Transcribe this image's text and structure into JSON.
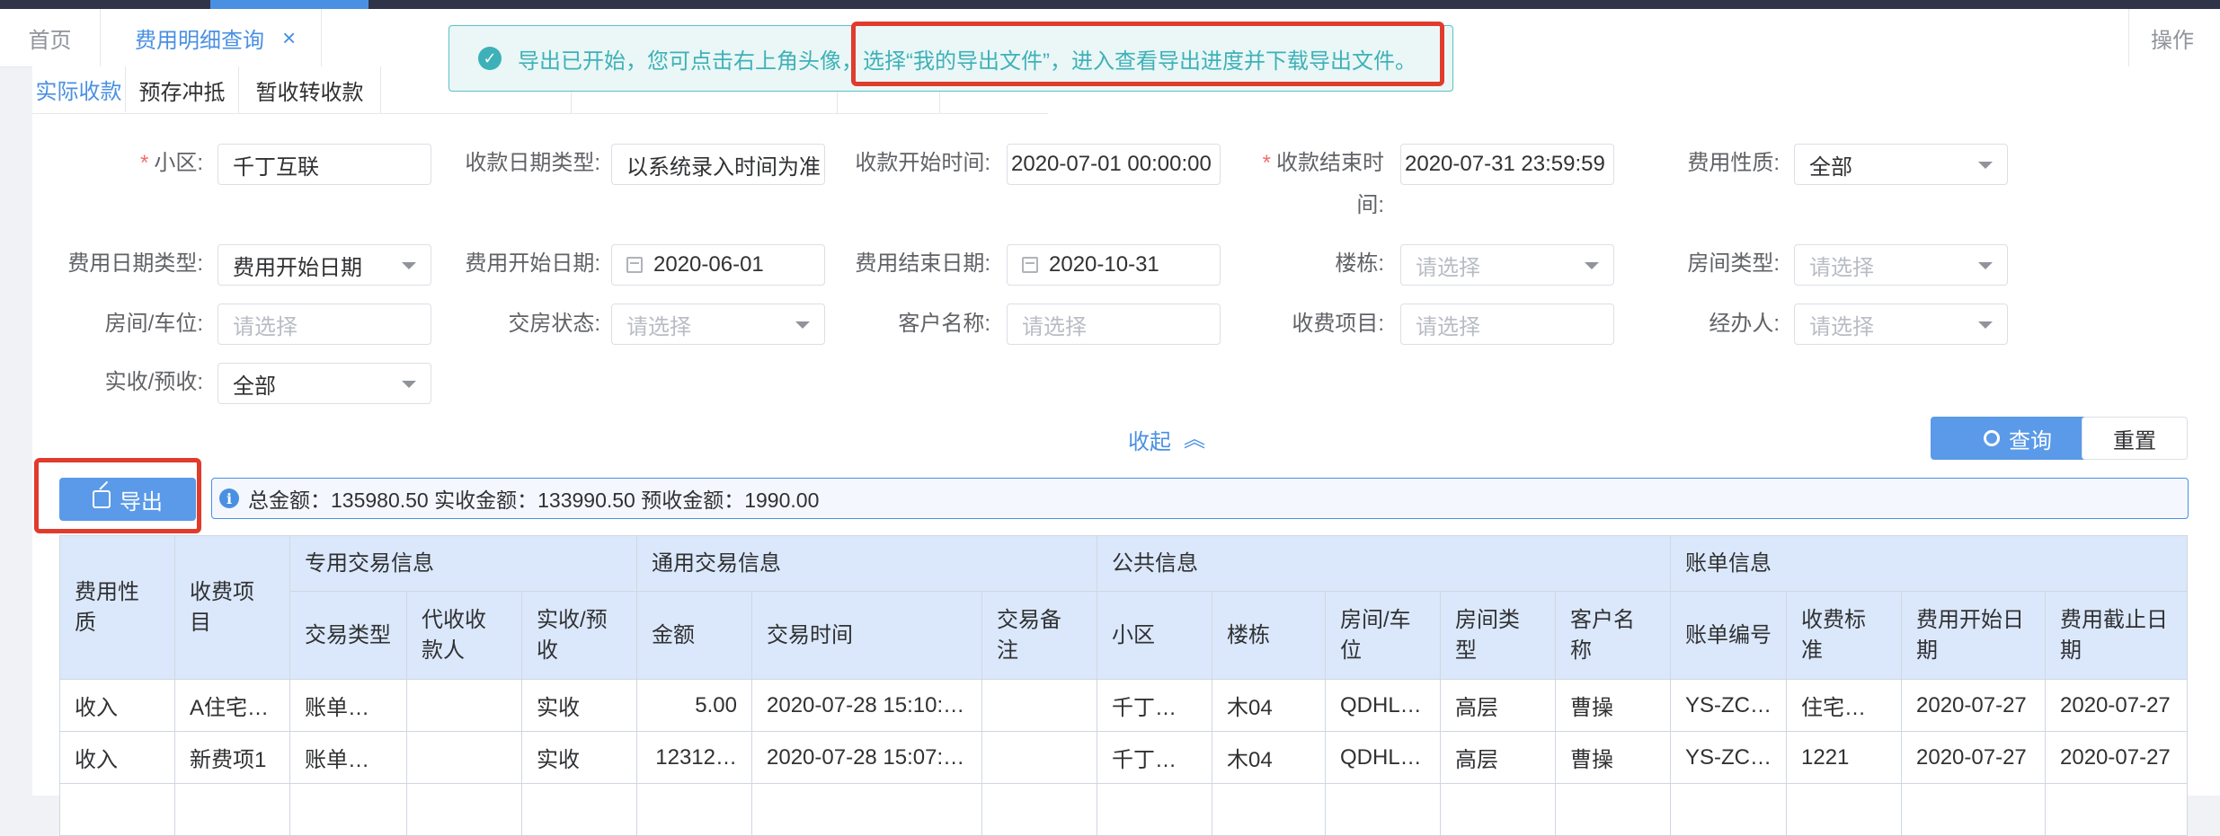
{
  "tabs": {
    "home": "首页",
    "current": "费用明细查询",
    "close": "×",
    "ops": "操作"
  },
  "subtabs": [
    "实际收款",
    "预存冲抵",
    "暂收转收款",
    "",
    "",
    ""
  ],
  "form": {
    "row1": [
      {
        "label": "小区:",
        "required": true,
        "value": "千丁互联",
        "type": "text"
      },
      {
        "label": "收款日期类型:",
        "required": false,
        "value": "以系统录入时间为准",
        "type": "text"
      },
      {
        "label": "收款开始时间:",
        "required": false,
        "value": "2020-07-01 00:00:00",
        "type": "text"
      },
      {
        "label": "收款结束时间:",
        "required": true,
        "value": "2020-07-31 23:59:59",
        "type": "text"
      },
      {
        "label": "费用性质:",
        "required": false,
        "value": "全部",
        "type": "select"
      }
    ],
    "row1_label4_part1": "收款结束时",
    "row1_label4_part2": "间:",
    "row2": [
      {
        "label": "费用日期类型:",
        "value": "费用开始日期",
        "type": "select"
      },
      {
        "label": "费用开始日期:",
        "value": "2020-06-01",
        "type": "date"
      },
      {
        "label": "费用结束日期:",
        "value": "2020-10-31",
        "type": "date"
      },
      {
        "label": "楼栋:",
        "value": "请选择",
        "type": "select-ph"
      },
      {
        "label": "房间类型:",
        "value": "请选择",
        "type": "select-ph"
      }
    ],
    "row3": [
      {
        "label": "房间/车位:",
        "value": "请选择",
        "type": "text-ph"
      },
      {
        "label": "交房状态:",
        "value": "请选择",
        "type": "select-ph"
      },
      {
        "label": "客户名称:",
        "value": "请选择",
        "type": "text-ph"
      },
      {
        "label": "收费项目:",
        "value": "请选择",
        "type": "text-ph"
      },
      {
        "label": "经办人:",
        "value": "请选择",
        "type": "select-ph"
      }
    ],
    "row4": [
      {
        "label": "实收/预收:",
        "value": "全部",
        "type": "select"
      }
    ]
  },
  "actions": {
    "collapse": "收起",
    "query": "查询",
    "reset": "重置",
    "export": "导出"
  },
  "summary": "总金额：135980.50 实收金额：133990.50 预收金额：1990.00",
  "toast": {
    "text": "导出已开始，您可点击右上角头像，选择“我的导出文件”，进入查看导出进度并下载导出文件。"
  },
  "table": {
    "groups": [
      "专用交易信息",
      "通用交易信息",
      "公共信息",
      "账单信息"
    ],
    "lead_headers": [
      "费用性质",
      "收费项目"
    ],
    "sub_headers": [
      "交易类型",
      "代收收款人",
      "实收/预收",
      "金额",
      "交易时间",
      "交易备注",
      "小区",
      "楼栋",
      "房间/车位",
      "房间类型",
      "客户名称",
      "账单编号",
      "收费标准",
      "费用开始日期",
      "费用截止日期"
    ],
    "rows": [
      [
        "收入",
        "A住宅…",
        "账单…",
        "",
        "实收",
        "5.00",
        "2020-07-28 15:10:…",
        "",
        "千丁…",
        "木04",
        "QDHL…",
        "高层",
        "曹操",
        "YS-ZC…",
        "住宅…",
        "2020-07-27",
        "2020-07-27"
      ],
      [
        "收入",
        "新费项1",
        "账单…",
        "",
        "实收",
        "12312…",
        "2020-07-28 15:07:…",
        "",
        "千丁…",
        "木04",
        "QDHL…",
        "高层",
        "曹操",
        "YS-ZC…",
        "1221",
        "2020-07-27",
        "2020-07-27"
      ],
      [
        "",
        "",
        "",
        "",
        "",
        "",
        "",
        "",
        "",
        "",
        "",
        "",
        "",
        "",
        "",
        "",
        ""
      ]
    ]
  },
  "colors": {
    "accent": "#4a90e2",
    "highlight": "#e03b2d",
    "success": "#3eb1b8"
  }
}
